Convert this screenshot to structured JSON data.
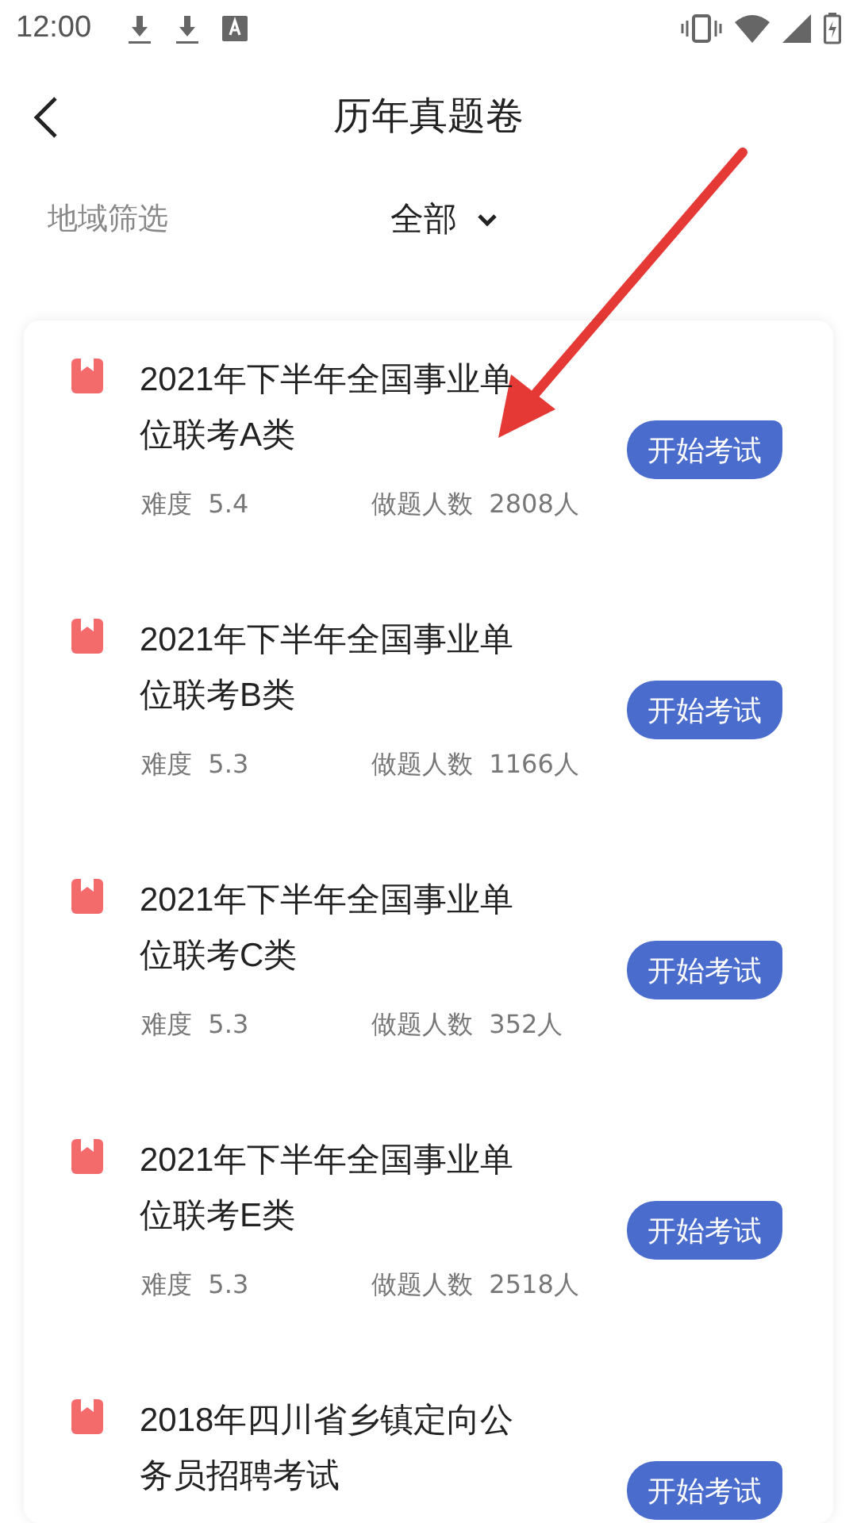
{
  "status_bar": {
    "time": "12:00"
  },
  "header": {
    "title": "历年真题卷"
  },
  "filter": {
    "label": "地域筛选",
    "value": "全部"
  },
  "papers": [
    {
      "title": "2021年下半年全国事业单位联考A类",
      "difficulty_label": "难度",
      "difficulty": "5.4",
      "takers_label": "做题人数",
      "takers": "2808人",
      "button": "开始考试"
    },
    {
      "title": "2021年下半年全国事业单位联考B类",
      "difficulty_label": "难度",
      "difficulty": "5.3",
      "takers_label": "做题人数",
      "takers": "1166人",
      "button": "开始考试"
    },
    {
      "title": "2021年下半年全国事业单位联考C类",
      "difficulty_label": "难度",
      "difficulty": "5.3",
      "takers_label": "做题人数",
      "takers": "352人",
      "button": "开始考试"
    },
    {
      "title": "2021年下半年全国事业单位联考E类",
      "difficulty_label": "难度",
      "difficulty": "5.3",
      "takers_label": "做题人数",
      "takers": "2518人",
      "button": "开始考试"
    },
    {
      "title": "2018年四川省乡镇定向公务员招聘考试",
      "button": "开始考试"
    }
  ]
}
